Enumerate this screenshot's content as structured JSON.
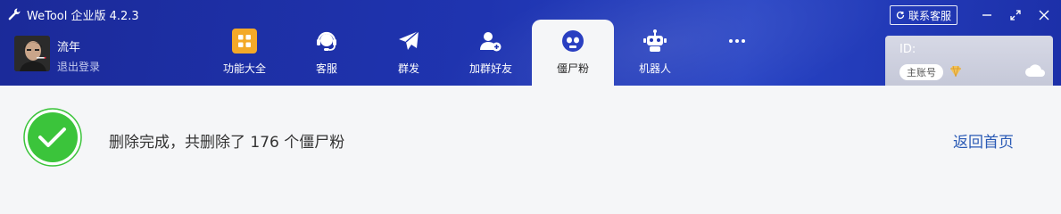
{
  "app": {
    "title": "WeTool 企业版 4.2.3"
  },
  "window": {
    "support_label": "联系客服"
  },
  "user": {
    "name": "流年",
    "logout_label": "退出登录"
  },
  "nav": [
    {
      "label": "功能大全",
      "icon": "grid-icon"
    },
    {
      "label": "客服",
      "icon": "headset-icon"
    },
    {
      "label": "群发",
      "icon": "send-icon"
    },
    {
      "label": "加群好友",
      "icon": "add-friend-icon"
    },
    {
      "label": "僵尸粉",
      "icon": "skull-icon",
      "active": true
    },
    {
      "label": "机器人",
      "icon": "robot-icon"
    },
    {
      "label": "",
      "icon": "more-icon"
    }
  ],
  "account": {
    "id_label": "ID:",
    "badge": "主账号"
  },
  "result": {
    "message": "删除完成，共删除了 176 个僵尸粉",
    "back_label": "返回首页"
  },
  "colors": {
    "header": "#1f34b0",
    "success": "#3bc43b",
    "link": "#2a5ab5"
  }
}
